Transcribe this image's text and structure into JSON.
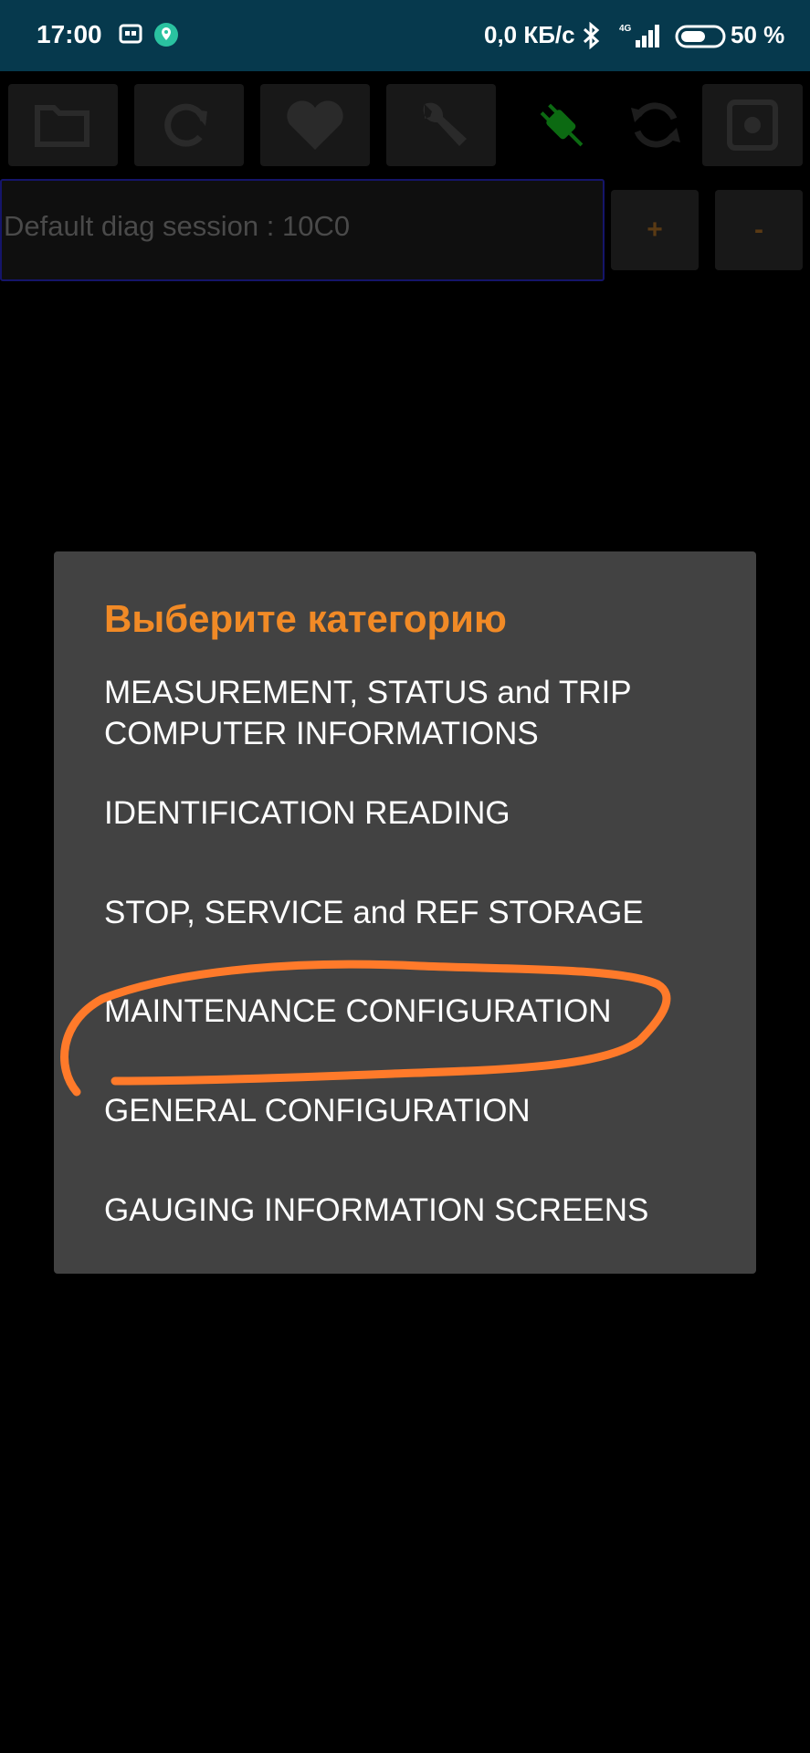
{
  "status_bar": {
    "time": "17:00",
    "network_speed": "0,0 КБ/с",
    "signal_type": "4G",
    "battery": "50 %"
  },
  "toolbar": {
    "icons": [
      "folder-icon",
      "refresh-icon",
      "heart-icon",
      "wrench-icon",
      "plug-icon",
      "sync-icon",
      "gear-icon"
    ]
  },
  "session": {
    "value": "Default diag session : 10C0",
    "plus_label": "+",
    "minus_label": "-"
  },
  "dialog": {
    "title": "Выберите категорию",
    "items": [
      {
        "label": "MEASUREMENT, STATUS and TRIP COMPUTER INFORMATIONS"
      },
      {
        "label": "IDENTIFICATION READING"
      },
      {
        "label": "STOP, SERVICE and REF STORAGE"
      },
      {
        "label": "MAINTENANCE CONFIGURATION"
      },
      {
        "label": "GENERAL CONFIGURATION"
      },
      {
        "label": "GAUGING INFORMATION SCREENS"
      }
    ]
  },
  "colors": {
    "status_bar_bg": "#06394d",
    "dialog_bg": "#424242",
    "title_accent": "#f18a26",
    "annotation_stroke": "#ff7a2a"
  }
}
